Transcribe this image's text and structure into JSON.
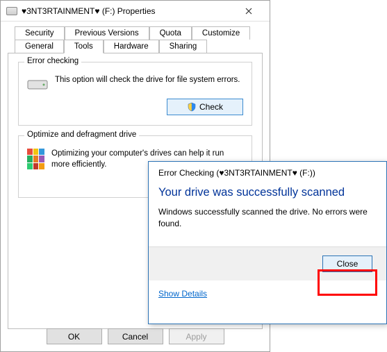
{
  "properties": {
    "title": "♥3NT3RTAINMENT♥ (F:) Properties",
    "tabs_row1": [
      "Security",
      "Previous Versions",
      "Quota",
      "Customize"
    ],
    "tabs_row2": [
      "General",
      "Tools",
      "Hardware",
      "Sharing"
    ],
    "active_tab": "Tools",
    "error_checking": {
      "legend": "Error checking",
      "text": "This option will check the drive for file system errors.",
      "button": "Check"
    },
    "defrag": {
      "legend": "Optimize and defragment drive",
      "text": "Optimizing your computer's drives can help it run more efficiently."
    },
    "buttons": {
      "ok": "OK",
      "cancel": "Cancel",
      "apply": "Apply"
    }
  },
  "dialog": {
    "title": "Error Checking (♥3NT3RTAINMENT♥ (F:))",
    "heading": "Your drive was successfully scanned",
    "body": "Windows successfully scanned the drive. No errors were found.",
    "close": "Close",
    "details": "Show Details"
  }
}
